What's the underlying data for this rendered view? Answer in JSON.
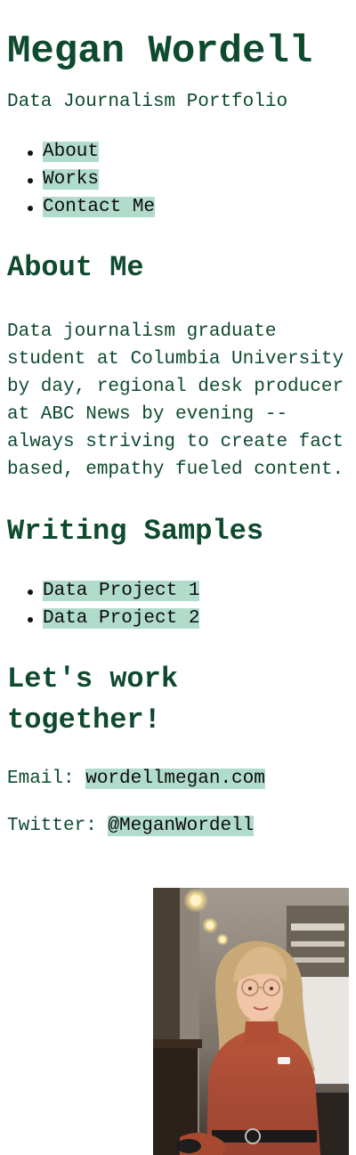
{
  "header": {
    "title": "Megan Wordell",
    "subtitle": "Data Journalism Portfolio"
  },
  "nav": {
    "items": [
      {
        "label": "About"
      },
      {
        "label": "Works"
      },
      {
        "label": "Contact Me"
      }
    ]
  },
  "about": {
    "heading": "About Me",
    "text": "Data journalism graduate student at Columbia University by day, regional desk producer at ABC News by evening -- always striving to create fact based, empathy fueled content."
  },
  "writing": {
    "heading": "Writing Samples",
    "items": [
      {
        "label": "Data Project 1"
      },
      {
        "label": "Data Project 2"
      }
    ]
  },
  "contact": {
    "heading": "Let's work together!",
    "email_label": "Email: ",
    "email_value": "wordellmegan.com",
    "twitter_label": "Twitter: ",
    "twitter_value": "@MeganWordell"
  },
  "photo": {
    "subject": "portrait-photo"
  },
  "colors": {
    "text": "#0e4a2e",
    "link_highlight": "#b1dccb",
    "background": "#ffffff"
  }
}
